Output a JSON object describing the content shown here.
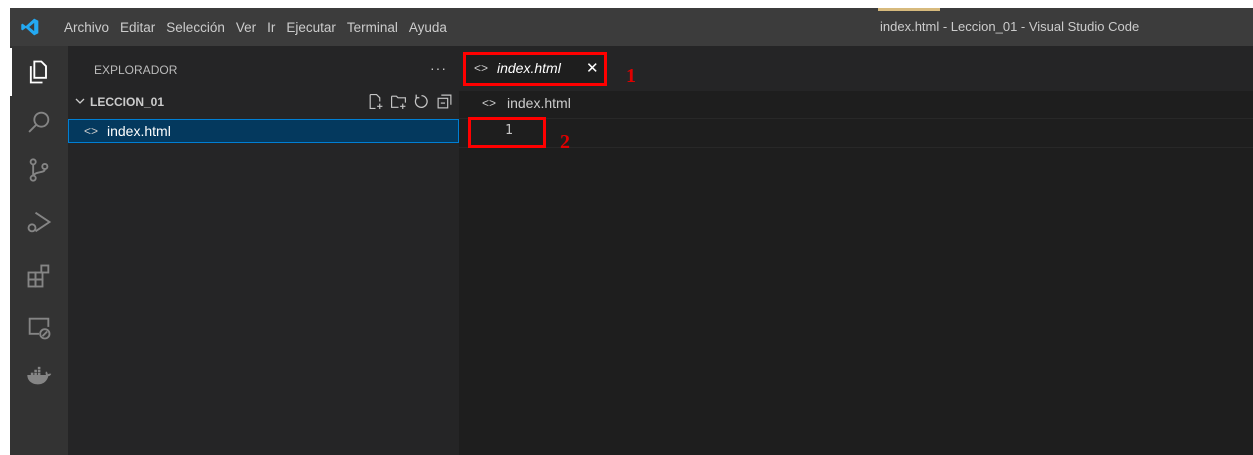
{
  "window": {
    "title": "index.html - Leccion_01 - Visual Studio Code"
  },
  "menu": {
    "items": [
      "Archivo",
      "Editar",
      "Selección",
      "Ver",
      "Ir",
      "Ejecutar",
      "Terminal",
      "Ayuda"
    ]
  },
  "activity_bar": {
    "icons": [
      "explorer-icon",
      "search-icon",
      "source-control-icon",
      "run-debug-icon",
      "extensions-icon",
      "remote-explorer-icon",
      "docker-icon"
    ]
  },
  "sidebar": {
    "title": "EXPLORADOR",
    "more": "···",
    "folder": "LECCION_01",
    "file_icon": "<>",
    "file": "index.html"
  },
  "editor": {
    "tab": {
      "icon": "<>",
      "label": "index.html",
      "close": "✕"
    },
    "breadcrumb": {
      "icon": "<>",
      "label": "index.html"
    },
    "line_number": "1"
  },
  "annotations": {
    "first": "1",
    "second": "2"
  },
  "colors": {
    "accent": "#007fd4",
    "annotation": "#ff0000",
    "background": "#1e1e1e",
    "sidebar": "#252526",
    "activity_bar": "#333333",
    "title_bar": "#3c3c3c"
  }
}
